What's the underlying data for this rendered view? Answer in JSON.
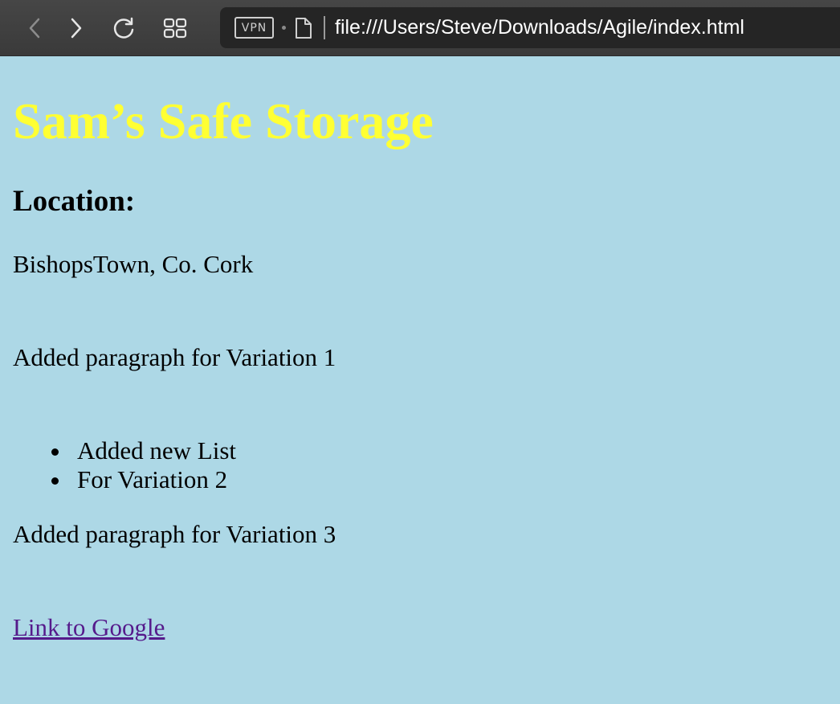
{
  "browser": {
    "url": "file:///Users/Steve/Downloads/Agile/index.html",
    "vpn_label": "VPN",
    "toolbar_color": "#3f3f3f",
    "urlbar_color": "#252525"
  },
  "page": {
    "background_color": "#add8e6",
    "title": "Sam’s Safe Storage",
    "title_color": "#ffff33",
    "location_heading": "Location:",
    "location_text": "BishopsTown, Co. Cork",
    "paragraph_1": "Added paragraph for Variation 1",
    "list_items": [
      "Added new List",
      "For Variation 2"
    ],
    "paragraph_3": "Added paragraph for Variation 3",
    "link_text": "Link to Google",
    "link_color": "#551a8b"
  }
}
